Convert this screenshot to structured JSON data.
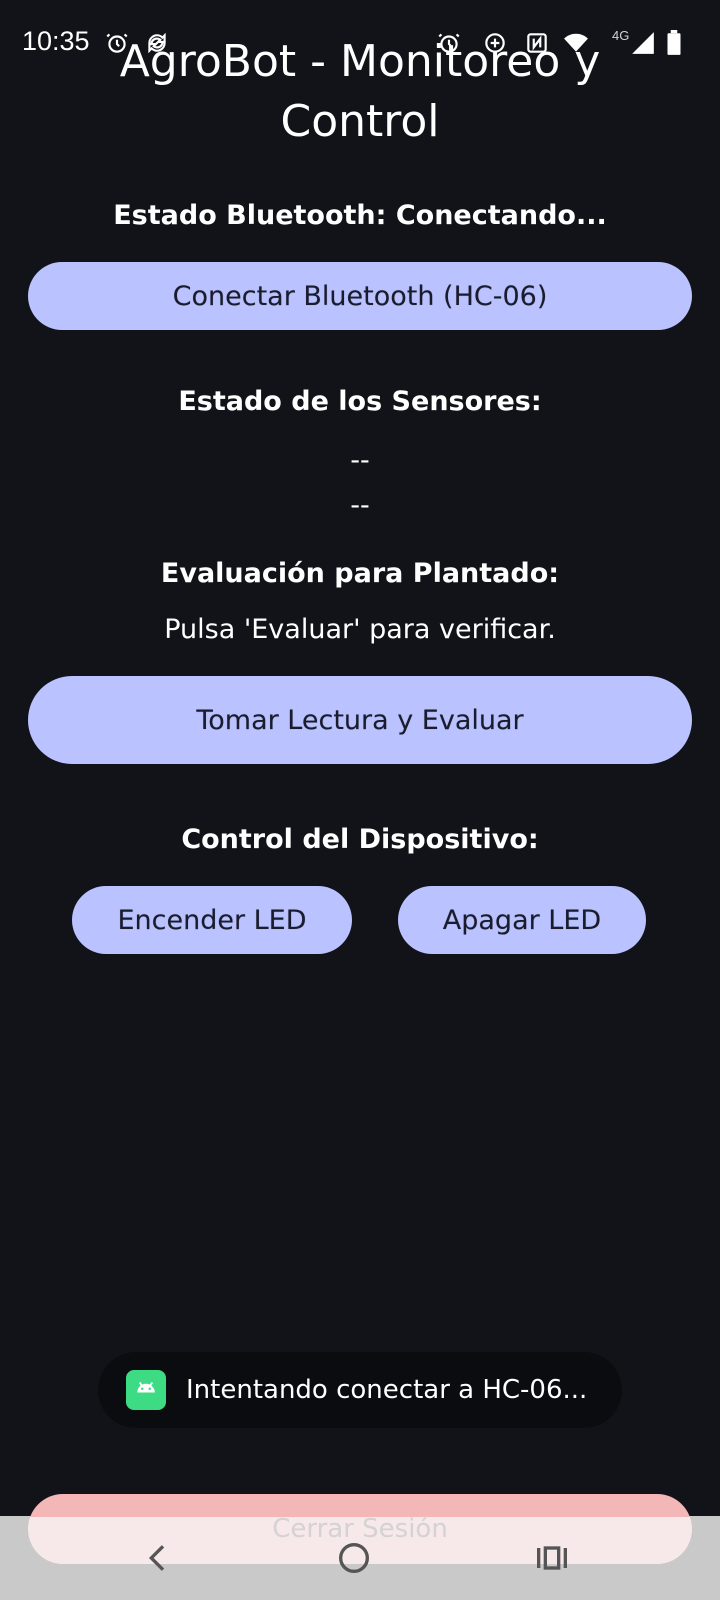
{
  "status_bar": {
    "time": "10:35",
    "network_label": "4G",
    "icons": [
      "alarm-icon",
      "sync-icon",
      "alarm-icon",
      "data-saver-icon",
      "nfc-icon",
      "wifi-icon",
      "cellular-signal-icon",
      "battery-icon"
    ]
  },
  "header": {
    "title": "AgroBot - Monitoreo y Control"
  },
  "bluetooth": {
    "status_text": "Estado Bluetooth: Conectando...",
    "connect_button": "Conectar Bluetooth (HC-06)"
  },
  "sensors": {
    "heading": "Estado de los Sensores:",
    "reading_1": "--",
    "reading_2": "--"
  },
  "evaluation": {
    "heading": "Evaluación para Plantado:",
    "message": "Pulsa 'Evaluar' para verificar.",
    "button": "Tomar Lectura y Evaluar"
  },
  "device_control": {
    "heading": "Control del Dispositivo:",
    "led_on_button": "Encender LED",
    "led_off_button": "Apagar LED"
  },
  "toast": {
    "message": "Intentando conectar a HC-06..."
  },
  "logout": {
    "button": "Cerrar Sesión"
  },
  "colors": {
    "background": "#121318",
    "button": "#bac3ff",
    "logout_button": "#f4b7b7",
    "toast_icon": "#3ddc84"
  }
}
